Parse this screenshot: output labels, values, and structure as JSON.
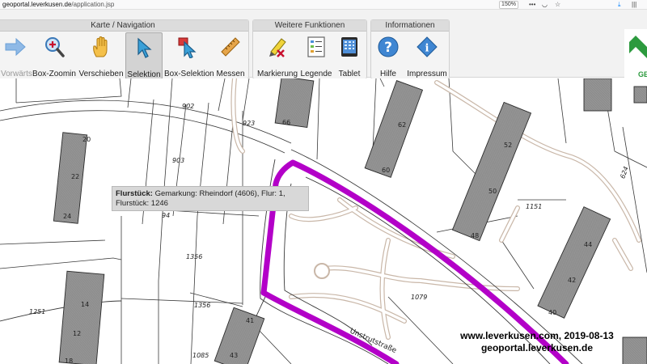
{
  "browser": {
    "url_host": "geoportal.leverkusen.de",
    "url_path": "/application.jsp",
    "zoom": "150%"
  },
  "toolbar": {
    "groups": [
      {
        "title": "Karte / Navigation",
        "tools": [
          {
            "label": "Vorwärts",
            "icon": "arrow-right-icon",
            "enabled": false
          },
          {
            "label": "Box-Zoomin",
            "icon": "zoom-in-icon"
          },
          {
            "label": "Verschieben",
            "icon": "pan-hand-icon"
          },
          {
            "label": "Selektion",
            "icon": "select-cursor-icon",
            "active": true
          },
          {
            "label": "Box-Selektion",
            "icon": "box-select-icon"
          },
          {
            "label": "Messen",
            "icon": "ruler-icon"
          }
        ]
      },
      {
        "title": "Weitere Funktionen",
        "tools": [
          {
            "label": "Markierung",
            "icon": "marker-pen-icon"
          },
          {
            "label": "Legende",
            "icon": "legend-icon"
          },
          {
            "label": "Tablet",
            "icon": "tablet-icon"
          }
        ]
      },
      {
        "title": "Informationen",
        "tools": [
          {
            "label": "Hilfe",
            "icon": "help-icon"
          },
          {
            "label": "Impressum",
            "icon": "info-icon"
          }
        ]
      }
    ],
    "logo_text": "GE"
  },
  "map": {
    "parcel_labels": [
      "902",
      "923",
      "903",
      "94",
      "1356",
      "1356",
      "1251",
      "1151",
      "1079",
      "1085",
      "624"
    ],
    "house_numbers": [
      "66",
      "20",
      "22",
      "24",
      "62",
      "60",
      "52",
      "50",
      "48",
      "14",
      "12",
      "41",
      "43",
      "44",
      "42",
      "40",
      "18"
    ],
    "street_label": "Unstrutstraße",
    "highlight_color": "#b300c8"
  },
  "tooltip": {
    "label": "Flurstück:",
    "text": " Gemarkung: Rheindorf (4606), Flur: 1, Flurstück: 1246"
  },
  "credit": {
    "line1": "www.leverkusen.com, 2019-08-13",
    "line2": "geoportal.leverkusen.de"
  }
}
